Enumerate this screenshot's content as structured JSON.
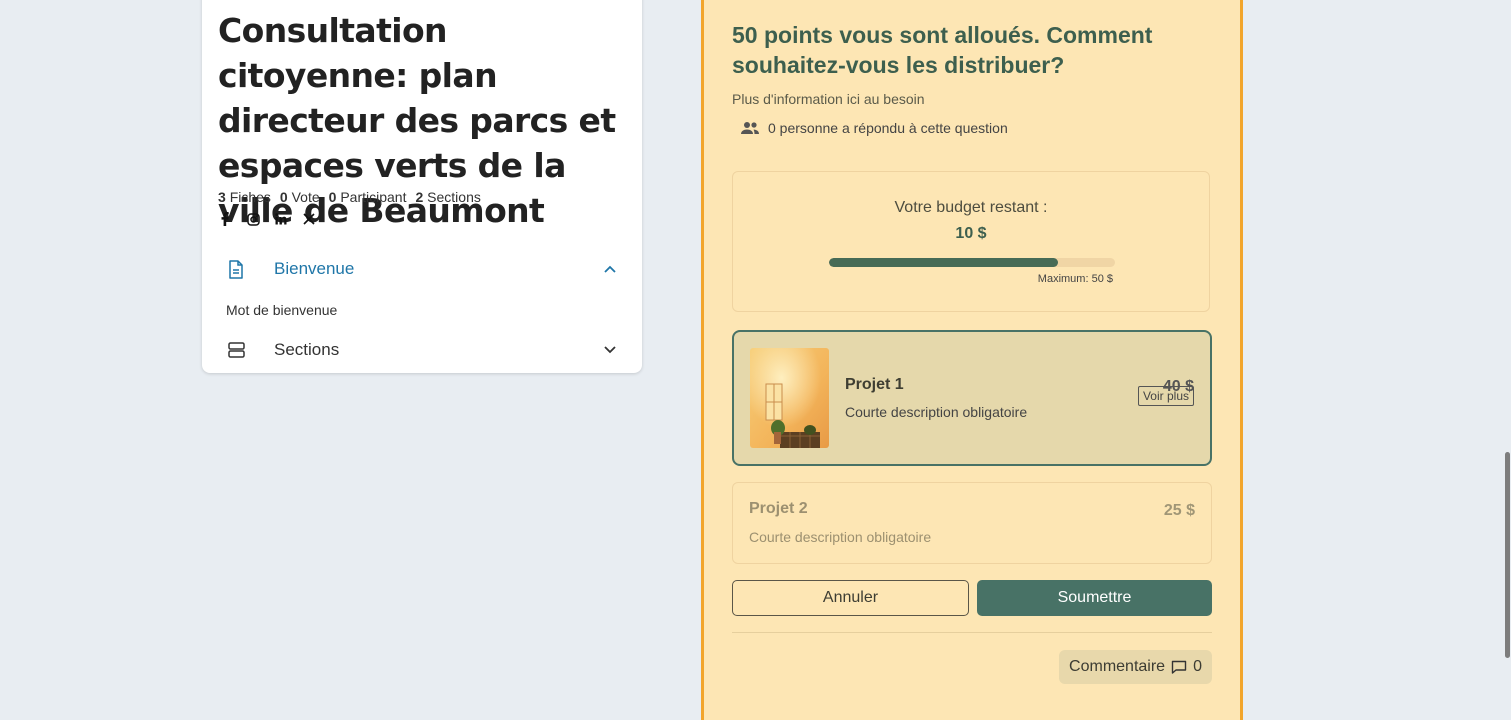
{
  "left": {
    "title": "Consultation citoyenne: plan directeur des parcs et espaces verts de la ville de Beaumont",
    "stats": [
      {
        "count": "3",
        "label": "Fiches"
      },
      {
        "count": "0",
        "label": "Vote"
      },
      {
        "count": "0",
        "label": "Participant"
      },
      {
        "count": "2",
        "label": "Sections"
      }
    ],
    "socials": [
      "facebook-icon",
      "instagram-icon",
      "linkedin-icon",
      "x-icon"
    ],
    "accordion": {
      "bienvenue_label": "Bienvenue",
      "bienvenue_item": "Mot de bienvenue",
      "sections_label": "Sections"
    }
  },
  "question": {
    "title": "50 points vous sont alloués. Comment souhaitez-vous les distribuer?",
    "help": "Plus d'information ici au besoin",
    "respondents": "0 personne a répondu à cette question",
    "budget": {
      "label": "Votre budget restant :",
      "value": "10 $",
      "max_label": "Maximum: 50 $",
      "fill_fraction": 0.8
    },
    "projects": [
      {
        "name": "Projet 1",
        "description": "Courte description obligatoire",
        "price": "40 $",
        "more": "Voir plus"
      },
      {
        "name": "Projet 2",
        "description": "Courte description obligatoire",
        "price": "25 $"
      }
    ],
    "cancel": "Annuler",
    "submit": "Soumettre",
    "comment_label": "Commentaire",
    "comment_count": "0"
  },
  "colors": {
    "accent_green": "#487266",
    "panel_bg": "#fde6b4",
    "panel_border": "#f2a52b",
    "link_blue": "#1f76a8"
  }
}
